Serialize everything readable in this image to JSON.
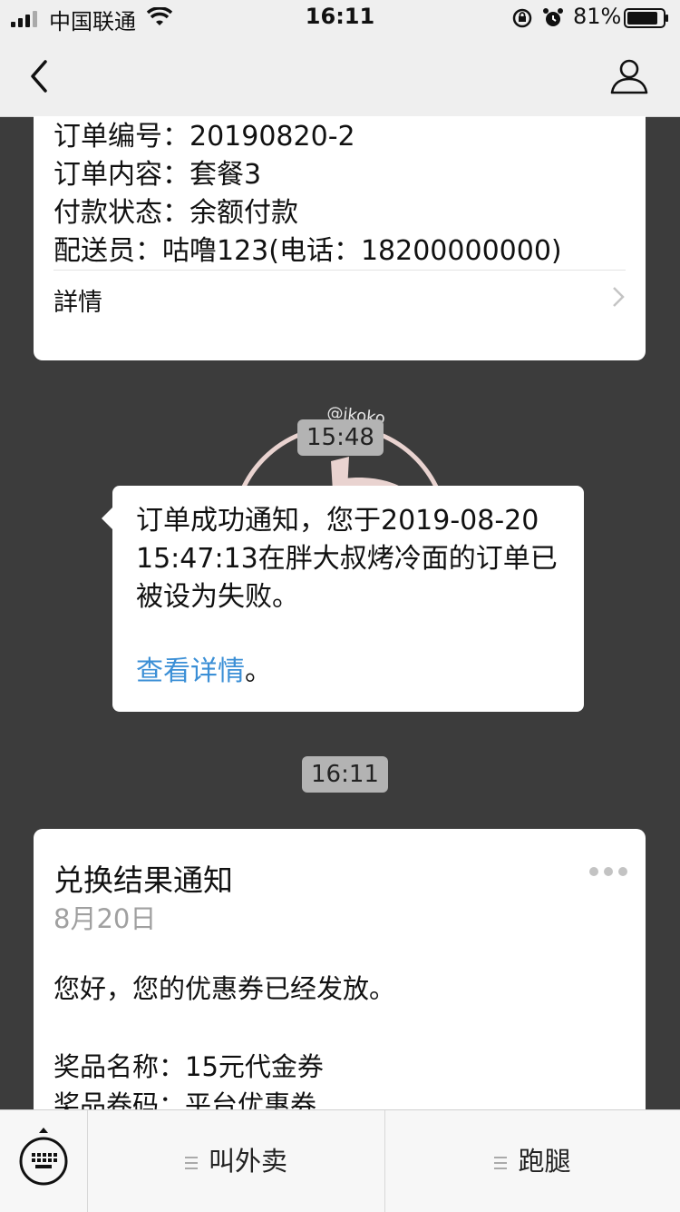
{
  "status_bar": {
    "carrier": "中国联通",
    "time": "16:11",
    "battery": "81%"
  },
  "card_order": {
    "lines": [
      "订单编号：20190820-2",
      "订单内容：套餐3",
      "付款状态：余额付款",
      "配送员：咕噜123(电话：18200000000)"
    ],
    "detail_label": "詳情"
  },
  "timestamps": [
    "15:48",
    "16:11"
  ],
  "bubble": {
    "message": "订单成功通知，您于2019-08-20 15:47:13在胖大叔烤冷面的订单已被设为失败。",
    "link_text": "查看详情",
    "link_suffix": "。"
  },
  "card_exchange": {
    "title": "兑换结果通知",
    "date": "8月20日",
    "greeting": "您好，您的优惠券已经发放。",
    "prize_name": "奖品名称：15元代金券",
    "prize_code": "奖品卷码：平台优惠券"
  },
  "watermark_text": "@ikoko",
  "bottom_menu": {
    "items": [
      "叫外卖",
      "跑腿"
    ]
  },
  "icons": {
    "back": "chevron-left-icon",
    "profile": "person-icon",
    "keyboard": "keyboard-icon",
    "menu": "menu-lines-icon",
    "more": "more-dots-icon"
  }
}
